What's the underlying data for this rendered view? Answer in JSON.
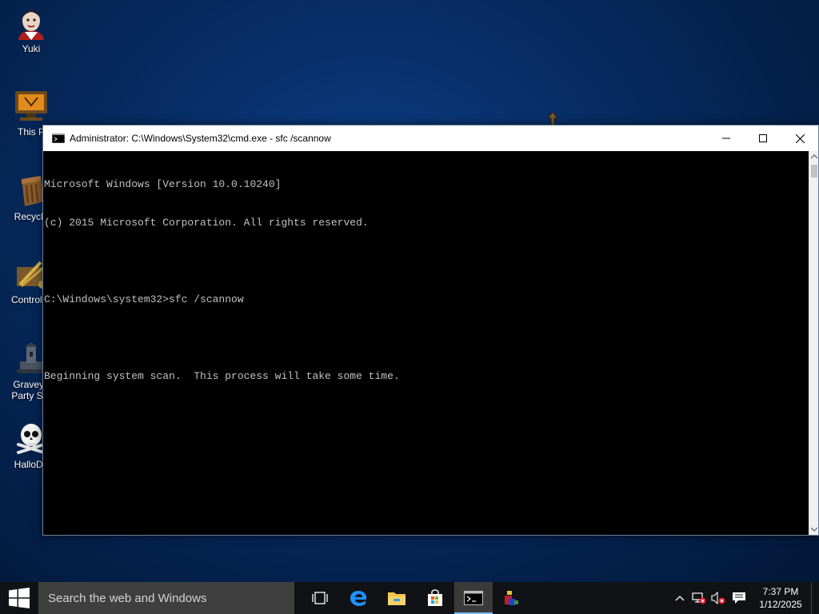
{
  "desktop": {
    "icons": [
      {
        "label": "Yuki"
      },
      {
        "label": "This P"
      },
      {
        "label": "Recycle"
      },
      {
        "label": "Control P"
      },
      {
        "label": "Graveya\nParty Scr"
      },
      {
        "label": "HalloDo"
      }
    ]
  },
  "window": {
    "title": "Administrator: C:\\Windows\\System32\\cmd.exe - sfc  /scannow",
    "console_lines": [
      "Microsoft Windows [Version 10.0.10240]",
      "(c) 2015 Microsoft Corporation. All rights reserved.",
      "",
      "C:\\Windows\\system32>sfc /scannow",
      "",
      "Beginning system scan.  This process will take some time."
    ]
  },
  "taskbar": {
    "search_placeholder": "Search the web and Windows",
    "clock_time": "7:37 PM",
    "clock_date": "1/12/2025"
  },
  "colors": {
    "console_bg": "#000000",
    "console_text": "#c0c0c0",
    "taskbar_bg": "#101215",
    "accent": "#76b9ed"
  }
}
